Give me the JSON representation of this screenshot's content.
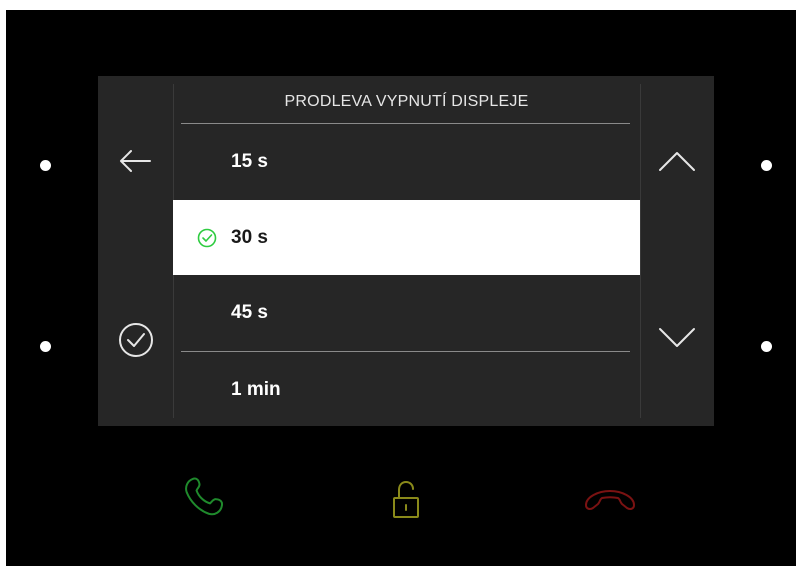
{
  "screen": {
    "title": "PRODLEVA VYPNUTÍ DISPLEJE",
    "selected_value": "30 s",
    "options": [
      {
        "label": "15 s",
        "selected": false
      },
      {
        "label": "30 s",
        "selected": true
      },
      {
        "label": "45 s",
        "selected": false
      },
      {
        "label": "1 min",
        "selected": false
      }
    ]
  },
  "icons": {
    "back": "arrow-left-icon",
    "confirm": "check-circle-icon",
    "scroll_up": "chevron-up-icon",
    "scroll_down": "chevron-down-icon",
    "selected_marker": "check-circle-icon",
    "answer_call": "phone-icon",
    "unlock": "unlock-icon",
    "hang_up": "phone-hangup-icon"
  },
  "colors": {
    "screen_bg": "#262626",
    "selected_bg": "#ffffff",
    "selected_check": "#2ecc40",
    "answer_call": "#1f8a2c",
    "unlock": "#8a8a1a",
    "hang_up": "#7a1212"
  }
}
